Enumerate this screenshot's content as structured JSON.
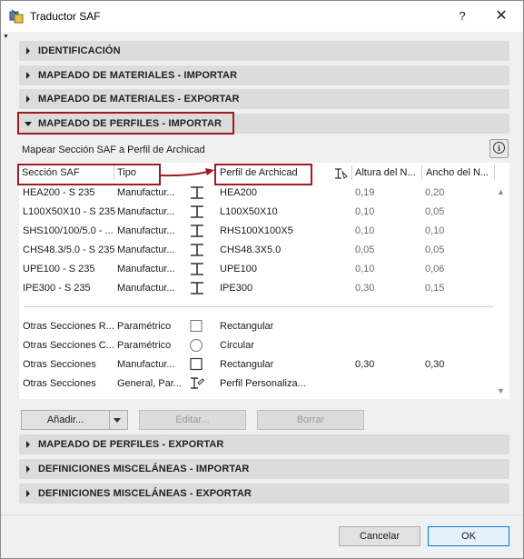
{
  "window": {
    "title": "Traductor SAF",
    "help": "?",
    "close": "✕"
  },
  "sections_top": [
    {
      "label": "IDENTIFICACIÓN"
    },
    {
      "label": "MAPEADO DE MATERIALES - IMPORTAR"
    },
    {
      "label": "MAPEADO DE MATERIALES - EXPORTAR"
    },
    {
      "label": "MAPEADO DE PERFILES - IMPORTAR"
    }
  ],
  "panel": {
    "subtitle": "Mapear Sección SAF a Perfil de Archicad",
    "info_glyph": "i"
  },
  "table": {
    "headers": {
      "saf_section": "Sección SAF",
      "type": "Tipo",
      "archicad_profile": "Perfil de Archicad",
      "height": "Altura del N...",
      "width": "Ancho del N..."
    },
    "rows": [
      {
        "section": "HEA200 - S 235",
        "type": "Manufactur...",
        "icon": "i-beam-icon",
        "profile": "HEA200",
        "height": "0,19",
        "width": "0,20"
      },
      {
        "section": "L100X50X10 - S 235",
        "type": "Manufactur...",
        "icon": "i-beam-icon",
        "profile": "L100X50X10",
        "height": "0,10",
        "width": "0,05"
      },
      {
        "section": "SHS100/100/5.0 - ...",
        "type": "Manufactur...",
        "icon": "i-beam-icon",
        "profile": "RHS100X100X5",
        "height": "0,10",
        "width": "0,10"
      },
      {
        "section": "CHS48.3/5.0 - S 235",
        "type": "Manufactur...",
        "icon": "i-beam-icon",
        "profile": "CHS48.3X5.0",
        "height": "0,05",
        "width": "0,05"
      },
      {
        "section": "UPE100 - S 235",
        "type": "Manufactur...",
        "icon": "i-beam-icon",
        "profile": "UPE100",
        "height": "0,10",
        "width": "0,06"
      },
      {
        "section": "IPE300 - S 235",
        "type": "Manufactur...",
        "icon": "i-beam-icon",
        "profile": "IPE300",
        "height": "0,30",
        "width": "0,15"
      }
    ],
    "other_rows": [
      {
        "section": "Otras Secciones R...",
        "type": "Paramétrico",
        "icon": "square-icon",
        "profile": "Rectangular",
        "height": "",
        "width": ""
      },
      {
        "section": "Otras Secciones C...",
        "type": "Paramétrico",
        "icon": "circle-icon",
        "profile": "Circular",
        "height": "",
        "width": ""
      },
      {
        "section": "Otras Secciones",
        "type": "Manufactur...",
        "icon": "square-icon",
        "profile": "Rectangular",
        "height": "0,30",
        "width": "0,30"
      },
      {
        "section": "Otras Secciones",
        "type": "General, Par...",
        "icon": "custom-profile-icon",
        "profile": "Perfil Personaliza...",
        "height": "",
        "width": ""
      }
    ]
  },
  "buttons": {
    "add": "Añadir...",
    "edit": "Editar...",
    "delete": "Borrar",
    "cancel": "Cancelar",
    "ok": "OK"
  },
  "sections_bottom": [
    {
      "label": "MAPEADO DE PERFILES - EXPORTAR"
    },
    {
      "label": "DEFINICIONES MISCELÁNEAS - IMPORTAR"
    },
    {
      "label": "DEFINICIONES MISCELÁNEAS - EXPORTAR"
    }
  ],
  "colors": {
    "highlight": "#a11a1f",
    "ok_border": "#0078d7"
  }
}
